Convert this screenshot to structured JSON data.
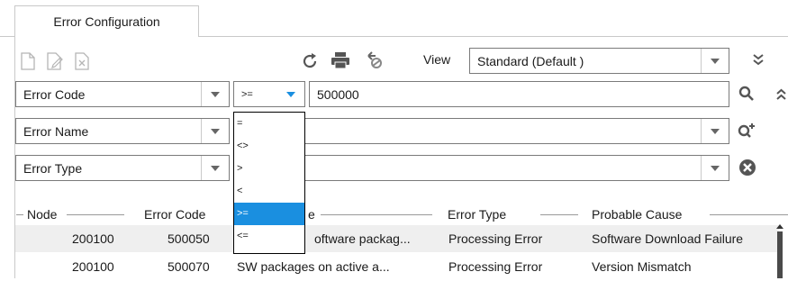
{
  "tab": {
    "label": "Error Configuration"
  },
  "toolbar": {
    "view_label": "View",
    "view_value": "Standard (Default )"
  },
  "filters": [
    {
      "field": "Error Code",
      "operator": ">=",
      "value": "500000"
    },
    {
      "field": "Error Name",
      "operator": "",
      "value": ""
    },
    {
      "field": "Error Type",
      "operator": "",
      "value": ""
    }
  ],
  "operator_options": [
    "=",
    "<>",
    ">",
    "<",
    ">=",
    "<="
  ],
  "selected_operator": ">=",
  "table": {
    "columns": [
      "Node",
      "Error Code",
      "e",
      "Error Type",
      "Probable Cause"
    ],
    "rows": [
      {
        "node": "200100",
        "code": "500050",
        "name": "oftware packag...",
        "type": "Processing Error",
        "cause": "Software Download Failure"
      },
      {
        "node": "200100",
        "code": "500070",
        "name": "SW packages on active a...",
        "type": "Processing Error",
        "cause": "Version Mismatch"
      }
    ]
  },
  "icons": {
    "new": "new-document-icon",
    "edit": "edit-document-icon",
    "delete": "delete-document-icon",
    "refresh": "refresh-icon",
    "print": "print-icon",
    "export": "export-icon",
    "expand": "double-chevron-down-icon",
    "collapse": "double-chevron-up-icon",
    "search": "search-icon",
    "add_filter": "add-filter-icon",
    "clear": "clear-icon"
  },
  "colors": {
    "accent": "#1a8fe0",
    "selection": "#1a8fe0"
  }
}
